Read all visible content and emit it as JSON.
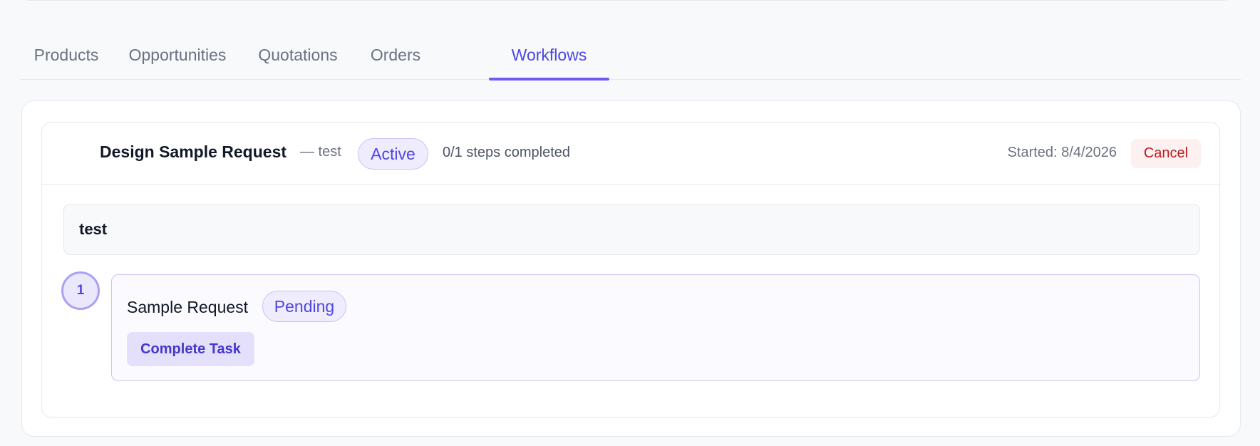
{
  "tabs": [
    {
      "label": "Products"
    },
    {
      "label": "Opportunities"
    },
    {
      "label": "Quotations"
    },
    {
      "label": "Orders"
    },
    {
      "label": "Workflows",
      "active": true
    }
  ],
  "workflow": {
    "title": "Design Sample Request",
    "subtitle": "— test",
    "status": "Active",
    "progress_text": "0/1 steps completed",
    "started_text": "Started: 8/4/2026",
    "cancel_label": "Cancel",
    "description": "test",
    "steps": [
      {
        "number": "1",
        "title": "Sample Request",
        "status": "Pending",
        "action_label": "Complete Task"
      }
    ]
  },
  "colors": {
    "accent": "#4f46e5",
    "accent_underline": "#6d5cf0",
    "badge_bg": "#efecfd",
    "cancel_text": "#b91c1c",
    "cancel_bg": "#fdf0f0"
  }
}
